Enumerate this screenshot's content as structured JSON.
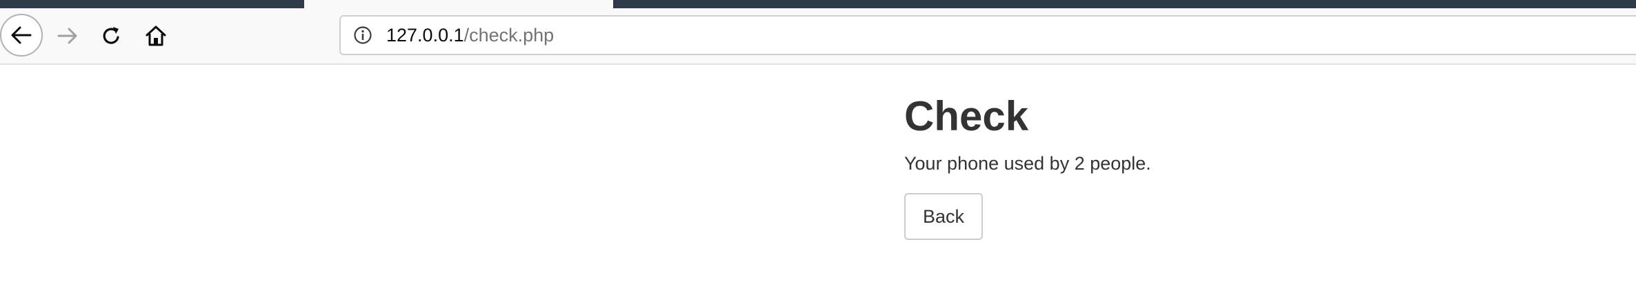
{
  "browser": {
    "url_host": "127.0.0.1",
    "url_path": "/check.php",
    "icons": {
      "back": "back-arrow-icon",
      "forward": "forward-arrow-icon",
      "reload": "reload-icon",
      "home": "home-icon",
      "info": "info-icon"
    }
  },
  "page": {
    "title": "Check",
    "message": "Your phone used by 2 people.",
    "back_label": "Back"
  },
  "colors": {
    "tabstrip": "#2e3a4a",
    "toolbar": "#f9f9fa",
    "text": "#333333"
  }
}
